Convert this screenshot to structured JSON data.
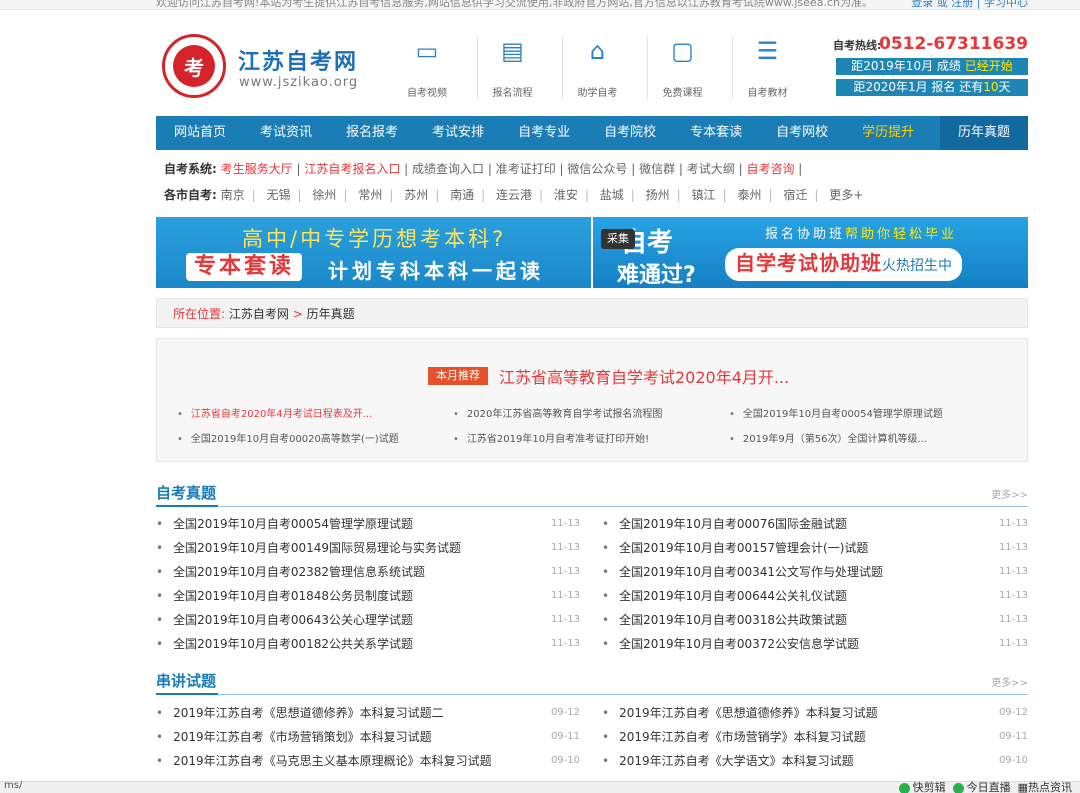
{
  "topbar": {
    "welcome": "欢迎访问江苏自考网!本站为考生提供江苏自考信息服务,网站信息供学习交流使用,非政府官方网站,官方信息以江苏教育考试院www.jseea.cn为准。",
    "login": "登录 或 注册 | 学习中心"
  },
  "header": {
    "site_name": "江苏自考网",
    "site_url": "www.jszikao.org",
    "quick_links": [
      {
        "label": "自考视频",
        "icon": "presentation-icon"
      },
      {
        "label": "报名流程",
        "icon": "book-icon"
      },
      {
        "label": "助学自考",
        "icon": "building-icon"
      },
      {
        "label": "免费课程",
        "icon": "classroom-icon"
      },
      {
        "label": "自考教材",
        "icon": "books-icon"
      }
    ],
    "hotline_label": "自考热线:",
    "hotline_number": "0512-67311639",
    "countdown1_pre": "距2019年10月 成绩",
    "countdown1_hi": "已经开始",
    "countdown2_pre": "距2020年1月 报名 还有",
    "countdown2_days": "10",
    "countdown2_post": "天"
  },
  "nav": {
    "items": [
      "网站首页",
      "考试资讯",
      "报名报考",
      "考试安排",
      "自考专业",
      "自考院校",
      "专本套读",
      "自考网校",
      "学历提升",
      "历年真题"
    ]
  },
  "system_row": {
    "label": "自考系统:",
    "items": [
      "考生服务大厅",
      "江苏自考报名入口",
      "成绩查询入口",
      "准考证打印",
      "微信公众号",
      "微信群",
      "考试大纲",
      "自考咨询"
    ]
  },
  "city_row": {
    "label": "各市自考:",
    "items": [
      "南京",
      "无锡",
      "徐州",
      "常州",
      "苏州",
      "南通",
      "连云港",
      "淮安",
      "盐城",
      "扬州",
      "镇江",
      "泰州",
      "宿迁",
      "更多+"
    ]
  },
  "banner": {
    "left_line1": "高中/中专学历想考本科?",
    "left_tag": "专本套读",
    "left_line2": "计划专科本科一起读",
    "right_collect": "采集",
    "right_big1": "自考",
    "right_big2": "难通过?",
    "right_small_pre": "报名协助班",
    "right_small_hi": "帮助你轻松毕业",
    "right_pill_main": "自学考试协助班",
    "right_pill_sub": "火热招生中"
  },
  "breadcrumb": {
    "label": "所在位置:",
    "home": "江苏自考网",
    "sep": ">",
    "current": "历年真题"
  },
  "recommend": {
    "badge": "本月推荐",
    "title": "江苏省高等教育自学考试2020年4月开...",
    "links": [
      "江苏省自考2020年4月考试日程表及开...",
      "2020年江苏省高等教育自学考试报名流程图",
      "全国2019年10月自考00054管理学原理试题",
      "全国2019年10月自考00020高等数学(一)试题",
      "江苏省2019年10月自考准考证打印开始!",
      "2019年9月（第56次）全国计算机等级..."
    ]
  },
  "section1": {
    "title": "自考真题",
    "more": "更多>>",
    "items": [
      {
        "t": "全国2019年10月自考00054管理学原理试题",
        "d": "11-13"
      },
      {
        "t": "全国2019年10月自考00076国际金融试题",
        "d": "11-13"
      },
      {
        "t": "全国2019年10月自考00149国际贸易理论与实务试题",
        "d": "11-13"
      },
      {
        "t": "全国2019年10月自考00157管理会计(一)试题",
        "d": "11-13"
      },
      {
        "t": "全国2019年10月自考02382管理信息系统试题",
        "d": "11-13"
      },
      {
        "t": "全国2019年10月自考00341公文写作与处理试题",
        "d": "11-13"
      },
      {
        "t": "全国2019年10月自考01848公务员制度试题",
        "d": "11-13"
      },
      {
        "t": "全国2019年10月自考00644公关礼仪试题",
        "d": "11-13"
      },
      {
        "t": "全国2019年10月自考00643公关心理学试题",
        "d": "11-13"
      },
      {
        "t": "全国2019年10月自考00318公共政策试题",
        "d": "11-13"
      },
      {
        "t": "全国2019年10月自考00182公共关系学试题",
        "d": "11-13"
      },
      {
        "t": "全国2019年10月自考00372公安信息学试题",
        "d": "11-13"
      }
    ]
  },
  "section2": {
    "title": "串讲试题",
    "more": "更多>>",
    "items": [
      {
        "t": "2019年江苏自考《思想道德修养》本科复习试题二",
        "d": "09-12"
      },
      {
        "t": "2019年江苏自考《思想道德修养》本科复习试题",
        "d": "09-12"
      },
      {
        "t": "2019年江苏自考《市场营销策划》本科复习试题",
        "d": "09-11"
      },
      {
        "t": "2019年江苏自考《市场营销学》本科复习试题",
        "d": "09-11"
      },
      {
        "t": "2019年江苏自考《马克思主义基本原理概论》本科复习试题",
        "d": "09-10"
      },
      {
        "t": "2019年江苏自考《大学语文》本科复习试题",
        "d": "09-10"
      }
    ]
  },
  "statusbar": {
    "url": "ms/",
    "tool1": "快剪辑",
    "tool2": "今日直播",
    "tool3": "热点资讯"
  },
  "colors": {
    "brand": "#1a7db6",
    "accent": "#e4393c",
    "highlight": "#ffd200"
  }
}
